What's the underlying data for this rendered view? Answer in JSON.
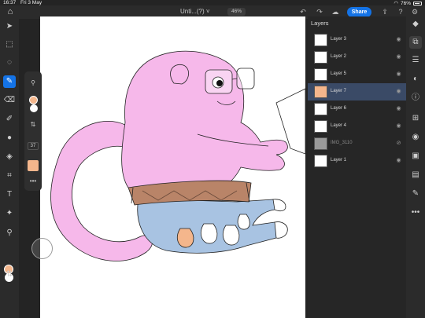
{
  "status": {
    "time": "16:37",
    "date": "Fri 3 May",
    "battery": "76%"
  },
  "topbar": {
    "title": "Unti...(?)",
    "zoom": "46%",
    "share_label": "Share"
  },
  "left_toolbar": {
    "tools": [
      "select-icon",
      "transform-icon",
      "lasso-icon",
      "brush-icon",
      "eraser-icon",
      "smudge-icon",
      "blur-icon",
      "fill-icon",
      "crop-icon",
      "text-icon",
      "effects-icon",
      "eyedropper-icon",
      "swap-icon"
    ]
  },
  "brush_flyout": {
    "size": "37"
  },
  "colors": {
    "primary": "#f4b68c",
    "secondary": "#ffffff",
    "accent": "#1473e6"
  },
  "layers": {
    "title": "Layers",
    "items": [
      {
        "name": "Layer 3",
        "visible": true,
        "selected": false
      },
      {
        "name": "Layer 2",
        "visible": true,
        "selected": false
      },
      {
        "name": "Layer 5",
        "visible": true,
        "selected": false
      },
      {
        "name": "Layer 7",
        "visible": true,
        "selected": true
      },
      {
        "name": "Layer 6",
        "visible": true,
        "selected": false
      },
      {
        "name": "Layer 4",
        "visible": true,
        "selected": false
      },
      {
        "name": "IMG_3110",
        "visible": false,
        "selected": false
      },
      {
        "name": "Layer 1",
        "visible": true,
        "selected": false
      }
    ]
  }
}
